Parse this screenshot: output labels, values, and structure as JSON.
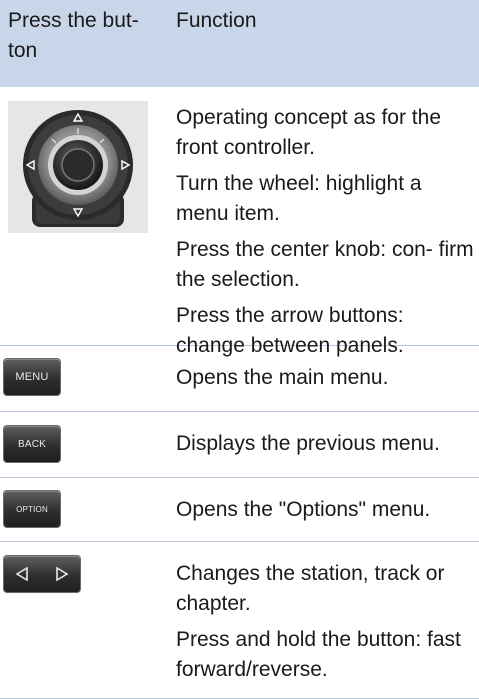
{
  "header": {
    "col1": "Press the but- ton",
    "col2": "Function"
  },
  "rows": [
    {
      "icon": "controller-icon",
      "paragraphs": [
        "Operating concept as for the front controller.",
        "Turn the wheel: highlight a menu item.",
        "Press the center knob: con- firm the selection.",
        "Press the arrow buttons: change between panels."
      ]
    },
    {
      "icon": "menu-button-icon",
      "icon_label": "MENU",
      "paragraphs": [
        "Opens the main menu."
      ]
    },
    {
      "icon": "back-button-icon",
      "icon_label": "BACK",
      "paragraphs": [
        "Displays the previous menu."
      ]
    },
    {
      "icon": "option-button-icon",
      "icon_label": "OPTION",
      "paragraphs": [
        "Opens the \"Options\" menu."
      ]
    },
    {
      "icon": "left-right-arrows-icon",
      "paragraphs": [
        "Changes the station, track or chapter.",
        "Press and hold the button: fast forward/reverse."
      ]
    }
  ],
  "colors": {
    "header_bg": "#c9d6e9",
    "row_divider": "#b7c7de"
  }
}
